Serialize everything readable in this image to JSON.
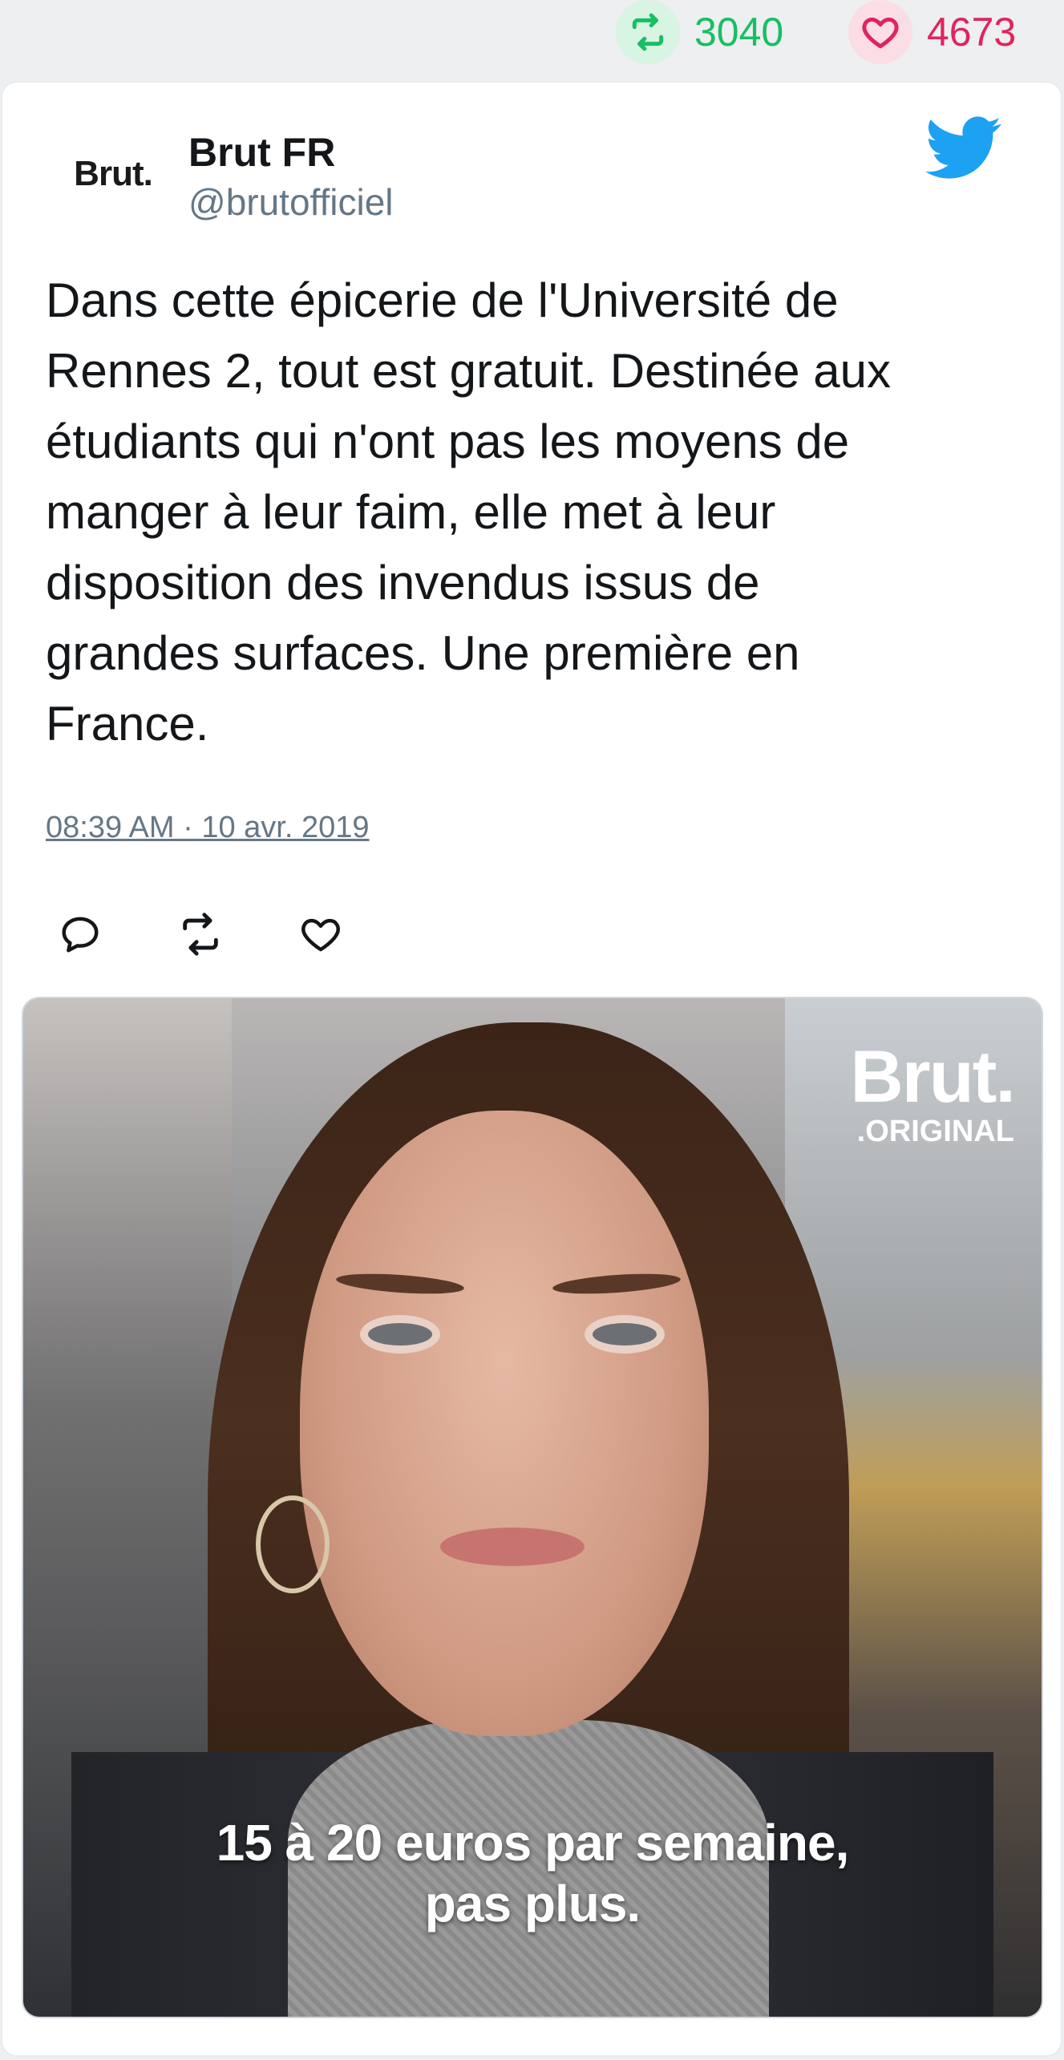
{
  "stats": {
    "retweet_count": "3040",
    "like_count": "4673",
    "retweet_icon": "retweet-icon",
    "like_icon": "heart-icon",
    "retweet_color": "#17bf63",
    "like_color": "#e0245e"
  },
  "tweet": {
    "author": {
      "avatar_text": "Brut.",
      "name": "Brut FR",
      "handle": "@brutofficiel"
    },
    "brand_icon": "twitter-bird-icon",
    "brand_color": "#1da1f2",
    "text": "Dans cette épicerie de l'Université de\nRennes 2, tout est gratuit. Destinée aux\nétudiants qui n'ont pas les moyens de\nmanger à leur faim, elle met à leur\ndisposition des invendus issus de\ngrandes surfaces. Une première en\nFrance.",
    "timestamp": "08:39 AM · 10 avr. 2019",
    "actions": [
      {
        "name": "reply",
        "icon": "reply-icon"
      },
      {
        "name": "retweet",
        "icon": "retweet-icon"
      },
      {
        "name": "like",
        "icon": "heart-icon"
      }
    ],
    "media": {
      "watermark_main": "Brut.",
      "watermark_sub": ".ORIGINAL",
      "subtitle": "15 à 20 euros par semaine,\npas plus."
    }
  }
}
